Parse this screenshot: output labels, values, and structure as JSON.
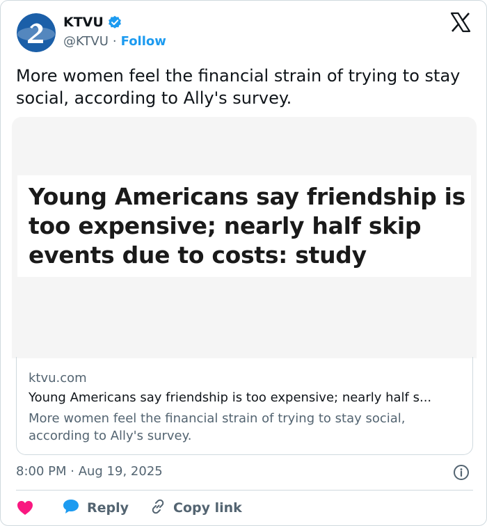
{
  "author": {
    "name": "KTVU",
    "handle": "@KTVU",
    "separator": "·",
    "follow_label": "Follow"
  },
  "tweet": {
    "text": "More women feel the financial strain of trying to stay social, according to Ally's survey."
  },
  "media": {
    "headline": "Young Americans say friendship is too expensive; nearly half skip events due to costs: study"
  },
  "link_card": {
    "domain": "ktvu.com",
    "title": "Young Americans say friendship is too expensive; nearly half s...",
    "description": "More women feel the financial strain of trying to stay social, according to Ally's survey."
  },
  "meta": {
    "timestamp": "8:00 PM · Aug 19, 2025"
  },
  "actions": {
    "reply_label": "Reply",
    "copy_link_label": "Copy link"
  },
  "colors": {
    "accent": "#1d9bf0",
    "like": "#f91880",
    "text_secondary": "#536471",
    "brand_blue": "#1b5fa8"
  },
  "icons": [
    "ktvu-logo-icon",
    "verified-badge-icon",
    "x-logo-icon",
    "info-icon",
    "heart-icon",
    "reply-bubble-icon",
    "link-icon"
  ]
}
